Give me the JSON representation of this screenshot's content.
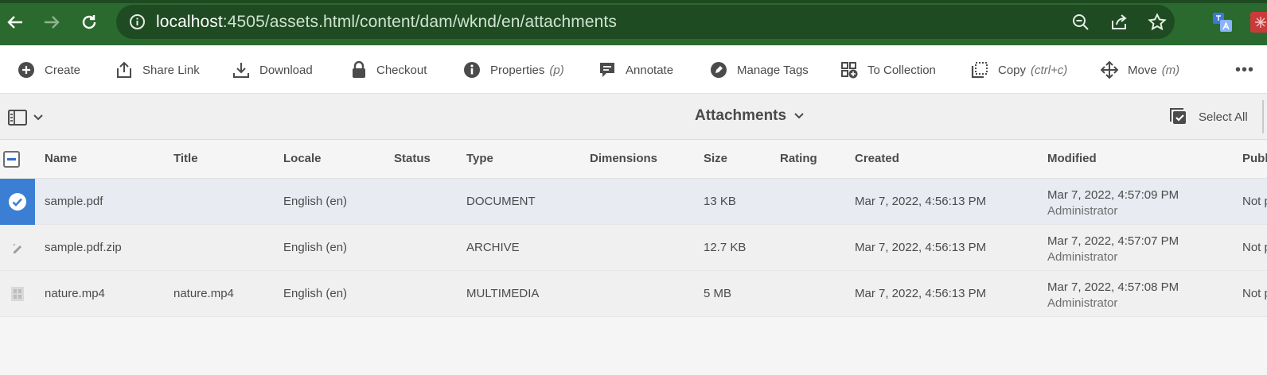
{
  "browser": {
    "url_host": "localhost",
    "url_path": ":4505/assets.html/content/dam/wknd/en/attachments",
    "accent": "#2b6a2e"
  },
  "toolbar": {
    "create": "Create",
    "share_link": "Share Link",
    "download": "Download",
    "checkout": "Checkout",
    "properties": "Properties",
    "properties_shortcut": "(p)",
    "annotate": "Annotate",
    "manage_tags": "Manage Tags",
    "to_collection": "To Collection",
    "copy": "Copy",
    "copy_shortcut": "(ctrl+c)",
    "move": "Move",
    "move_shortcut": "(m)",
    "more": "•••"
  },
  "titlebar": {
    "folder_title": "Attachments",
    "select_all": "Select All"
  },
  "table": {
    "columns": [
      "Name",
      "Title",
      "Locale",
      "Status",
      "Type",
      "Dimensions",
      "Size",
      "Rating",
      "Created",
      "Modified",
      "Publi"
    ],
    "rows": [
      {
        "name": "sample.pdf",
        "title": "",
        "locale": "English (en)",
        "status": "",
        "type": "DOCUMENT",
        "dimensions": "",
        "size": "13 KB",
        "rating": "",
        "created": "Mar 7, 2022, 4:56:13 PM",
        "modified": "Mar 7, 2022, 4:57:09 PM",
        "modified_by": "Administrator",
        "published": "Not p",
        "selected": true
      },
      {
        "name": "sample.pdf.zip",
        "title": "",
        "locale": "English (en)",
        "status": "",
        "type": "ARCHIVE",
        "dimensions": "",
        "size": "12.7 KB",
        "rating": "",
        "created": "Mar 7, 2022, 4:56:13 PM",
        "modified": "Mar 7, 2022, 4:57:07 PM",
        "modified_by": "Administrator",
        "published": "Not p",
        "selected": false
      },
      {
        "name": "nature.mp4",
        "title": "nature.mp4",
        "locale": "English (en)",
        "status": "",
        "type": "MULTIMEDIA",
        "dimensions": "",
        "size": "5 MB",
        "rating": "",
        "created": "Mar 7, 2022, 4:56:13 PM",
        "modified": "Mar 7, 2022, 4:57:08 PM",
        "modified_by": "Administrator",
        "published": "Not p",
        "selected": false
      }
    ]
  }
}
